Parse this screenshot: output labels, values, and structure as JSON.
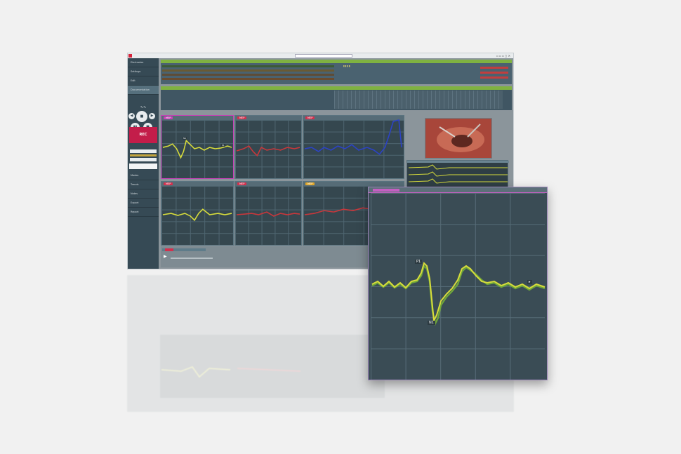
{
  "window": {
    "title_text": "",
    "search_placeholder": ""
  },
  "sidebar": {
    "items": [
      {
        "label": "Electrodes"
      },
      {
        "label": "Settings"
      },
      {
        "label": "Edit"
      },
      {
        "label": "Documentation"
      }
    ],
    "record_label": "REC",
    "lower_items": [
      {
        "label": "Modes"
      },
      {
        "label": "Trends"
      },
      {
        "label": "Notes"
      },
      {
        "label": "Export"
      },
      {
        "label": "Report"
      }
    ]
  },
  "panels": [
    {
      "id": "p1",
      "label": "MEP",
      "color": "#c93fb8",
      "trace_color": "#d7dc3b"
    },
    {
      "id": "p2",
      "label": "MEP",
      "color": "#d3304d",
      "trace_color": "#c9373b"
    },
    {
      "id": "p3",
      "label": "MEP",
      "color": "#d3304d",
      "trace_color": "#2c43c7"
    },
    {
      "id": "p4",
      "label": "MEP",
      "color": "#d3304d",
      "trace_color": "#d7dc3b"
    },
    {
      "id": "p5",
      "label": "MEP",
      "color": "#d3304d",
      "trace_color": "#c9373b"
    },
    {
      "id": "p6",
      "label": "MEP",
      "color": "#e0a72a",
      "trace_color": "#c9373b"
    }
  ],
  "zoom_panel": {
    "trace_color": "#d7dc3b",
    "ref_color": "#6fa63a",
    "border_color": "#c45fc2"
  },
  "colors": {
    "accent_green": "#7fb241",
    "record_red": "#c31d4a",
    "panel_bg": "#35474f"
  }
}
